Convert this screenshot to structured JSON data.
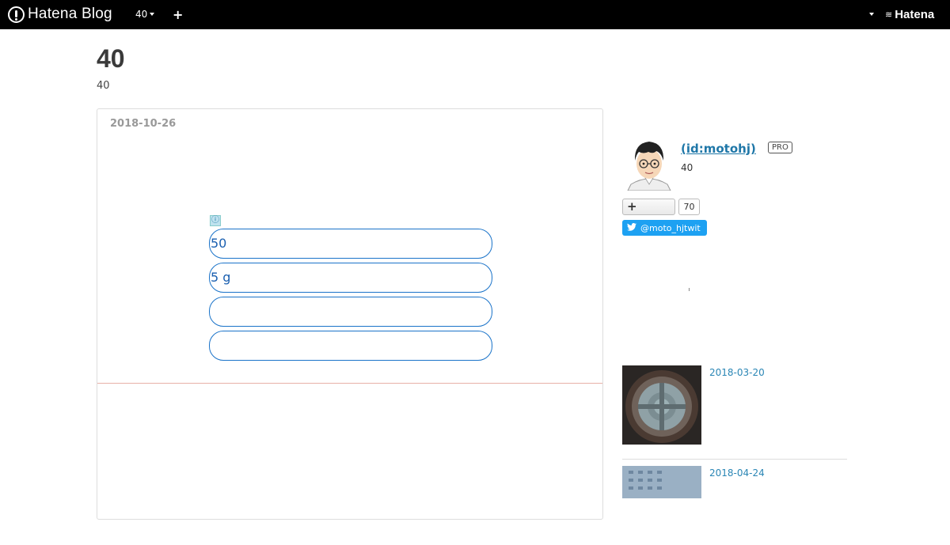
{
  "topbar": {
    "logo_text": "Hatena Blog",
    "blog_select": "40",
    "add_label": "+",
    "brand": "Hatena"
  },
  "header": {
    "title": "40",
    "description": "40"
  },
  "article": {
    "date": "2018-10-26",
    "info_icon": "ⓘ",
    "options": [
      "50",
      "5 g",
      "",
      ""
    ]
  },
  "sidebar": {
    "author_link": " (id:motohj)",
    "pro_badge": "PRO",
    "author_description": "40",
    "subscribe_label": "+",
    "subscriber_count": "70",
    "twitter_label": "@moto_hjtwit",
    "entries": [
      {
        "date": "2018-03-20"
      },
      {
        "date": "2018-04-24"
      }
    ]
  },
  "colors": {
    "topbar": "#000000",
    "link": "#1f77a8",
    "option_border": "#1a73c9",
    "twitter": "#1da1f2"
  },
  "icons": [
    "hatena-blog-logo-icon",
    "caret-down-icon",
    "plus-icon",
    "hatena-mark-icon",
    "info-icon",
    "twitter-bird-icon"
  ]
}
